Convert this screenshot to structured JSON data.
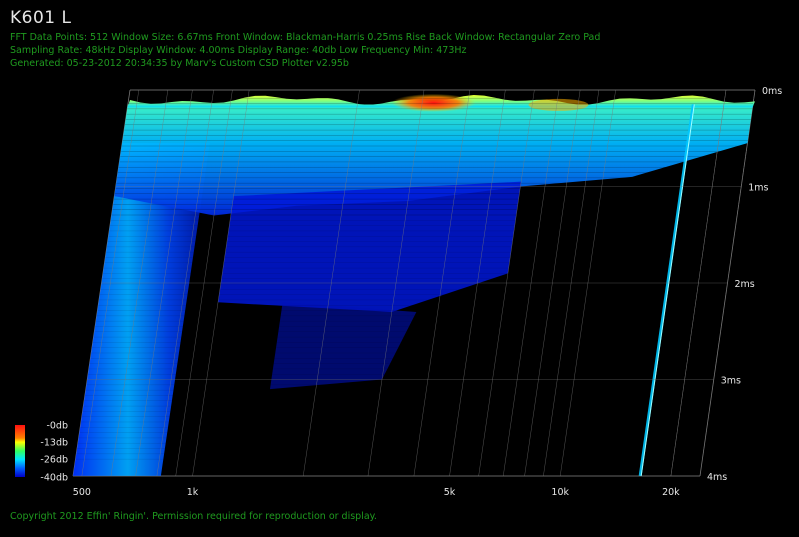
{
  "header": {
    "title": "K601 L",
    "line1": "FFT Data Points: 512   Window Size: 6.67ms   Front Window: Blackman-Harris 0.25ms Rise   Back Window: Rectangular Zero Pad",
    "line2": "Sampling Rate: 48kHz   Display Window: 4.00ms   Display Range: 40db   Low Frequency Min: 473Hz",
    "line3": "Generated: 05-23-2012 20:34:35 by Marv's Custom CSD Plotter v2.95b"
  },
  "footer": {
    "copyright": "Copyright 2012 Effin' Ringin'. Permission required for reproduction or display."
  },
  "colors": {
    "text": "#e6e6e6",
    "info": "#1f9a1f",
    "grid": "#7a7a7a"
  },
  "chart_data": {
    "type": "heatmap",
    "subtype": "3d-waterfall",
    "x_axis": {
      "scale": "log",
      "range": [
        473,
        24000
      ],
      "ticks": [
        {
          "value": 500,
          "label": "500"
        },
        {
          "value": 1000,
          "label": "1k"
        },
        {
          "value": 5000,
          "label": "5k"
        },
        {
          "value": 10000,
          "label": "10k"
        },
        {
          "value": 20000,
          "label": "20k"
        }
      ]
    },
    "time_axis": {
      "range": [
        0,
        4
      ],
      "ticks": [
        {
          "value": 0,
          "label": "0ms"
        },
        {
          "value": 1,
          "label": "1ms"
        },
        {
          "value": 2,
          "label": "2ms"
        },
        {
          "value": 3,
          "label": "3ms"
        },
        {
          "value": 4,
          "label": "4ms"
        }
      ]
    },
    "color_scale": [
      {
        "db": 0,
        "label": "-0db",
        "color": "#ff1010"
      },
      {
        "db": -13,
        "label": "-13db",
        "color": "#ffff00"
      },
      {
        "db": -26,
        "label": "-26db",
        "color": "#00e8ff"
      },
      {
        "db": -40,
        "label": "-40db",
        "color": "#0000c8"
      }
    ]
  }
}
